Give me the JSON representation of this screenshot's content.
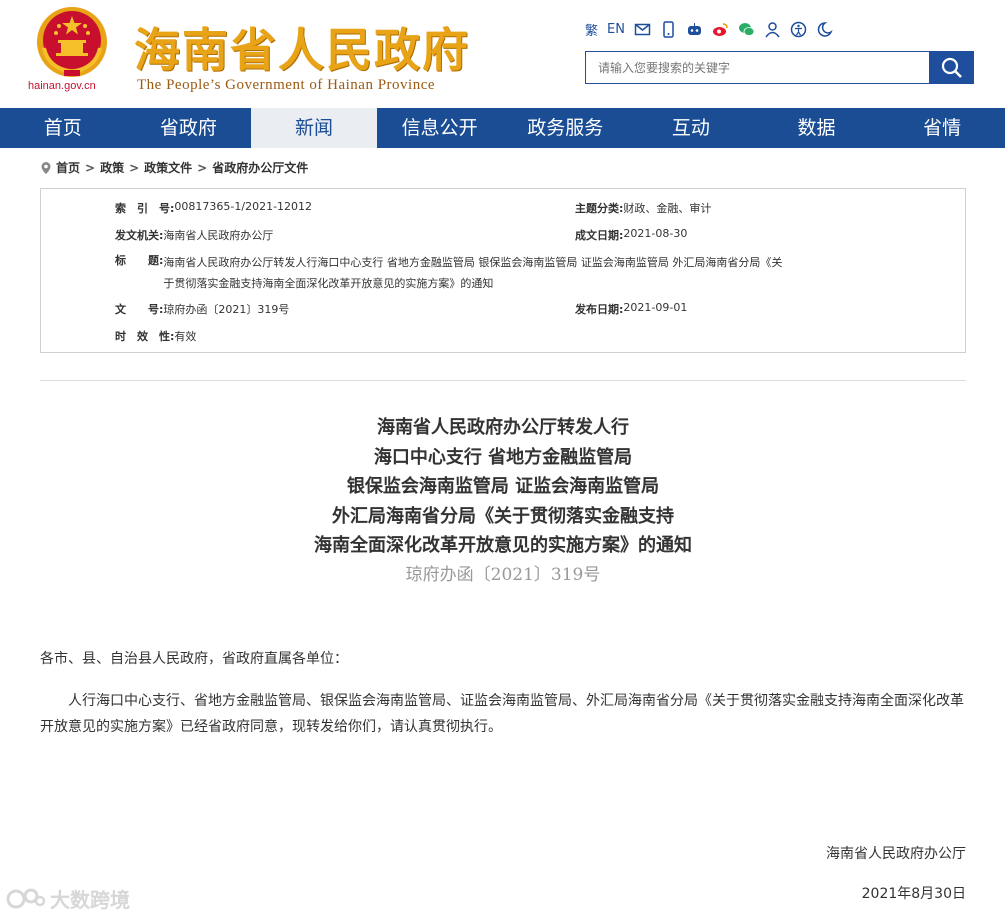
{
  "header": {
    "site_url": "hainan.gov.cn",
    "brand_cn": "海南省人民政府",
    "brand_en": "The People’s Government  of Hainan Province",
    "toolbar": {
      "traditional": "繁",
      "english": "EN",
      "icons": [
        "mail-icon",
        "mobile-icon",
        "robot-icon",
        "weibo-icon",
        "wechat-icon",
        "user-icon",
        "accessibility-icon",
        "elder-mode-icon"
      ]
    },
    "search": {
      "placeholder": "请输入您要搜索的关键字"
    }
  },
  "nav": {
    "items": [
      "首页",
      "省政府",
      "新闻",
      "信息公开",
      "政务服务",
      "互动",
      "数据",
      "省情"
    ],
    "active_index": 2
  },
  "breadcrumb": {
    "items": [
      "首页",
      "政策",
      "政策文件",
      "省政府办公厅文件"
    ],
    "separator": ">"
  },
  "info": {
    "index_label": "索　引　号:",
    "index_value": "00817365-1/2021-12012",
    "topic_label": "主题分类:",
    "topic_value": "财政、金融、审计",
    "issuer_label": "发文机关:",
    "issuer_value": "海南省人民政府办公厅",
    "created_label": "成文日期:",
    "created_value": "2021-08-30",
    "title_label": "标　　题:",
    "title_value_1": "海南省人民政府办公厅转发人行海口中心支行 省地方金融监管局 银保监会海南监管局 证监会海南监管局 外汇局海南省分局《关",
    "title_value_2": "于贯彻落实金融支持海南全面深化改革开放意见的实施方案》的通知",
    "docno_label": "文　　号:",
    "docno_value": "琼府办函〔2021〕319号",
    "published_label": "发布日期:",
    "published_value": "2021-09-01",
    "validity_label": "时　效　性:",
    "validity_value": "有效"
  },
  "document": {
    "title_lines": [
      "海南省人民政府办公厅转发人行",
      "海口中心支行 省地方金融监管局",
      "银保监会海南监管局 证监会海南监管局",
      "外汇局海南省分局《关于贯彻落实金融支持",
      "海南全面深化改革开放意见的实施方案》的通知"
    ],
    "doc_number": "琼府办函〔2021〕319号",
    "salutation": "各市、县、自治县人民政府，省政府直属各单位：",
    "paragraph": "人行海口中心支行、省地方金融监管局、银保监会海南监管局、证监会海南监管局、外汇局海南省分局《关于贯彻落实金融支持海南全面深化改革开放意见的实施方案》已经省政府同意，现转发给你们，请认真贯彻执行。",
    "signer": "海南省人民政府办公厅",
    "date": "2021年8月30日"
  },
  "watermark": {
    "text": "大数跨境"
  },
  "colors": {
    "nav_blue": "#1b4d94",
    "brand_gold": "#e8a317",
    "emblem_red": "#c8102e"
  }
}
